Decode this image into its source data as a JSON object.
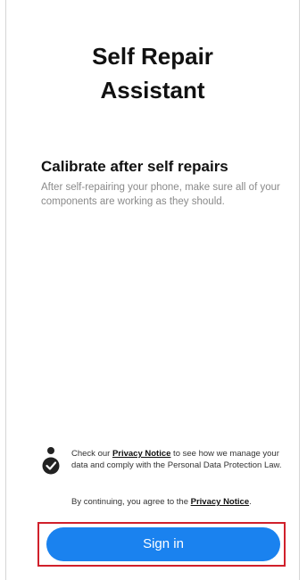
{
  "app": {
    "title_line1": "Self Repair",
    "title_line2": "Assistant"
  },
  "intro": {
    "heading": "Calibrate after self repairs",
    "description": "After self-repairing your phone, make sure all of your components are working as they should."
  },
  "privacy": {
    "icon": "privacy-person-check-icon",
    "text_before": "Check our ",
    "link_label": "Privacy Notice",
    "text_after": " to see how we manage your data and comply with the Personal Data Protection Law.",
    "agree_before": "By continuing, you agree to the ",
    "agree_link_label": "Privacy Notice",
    "agree_after": "."
  },
  "actions": {
    "sign_in_label": "Sign in"
  },
  "colors": {
    "primary_button": "#1a82ef",
    "highlight_box": "#d0202b"
  }
}
